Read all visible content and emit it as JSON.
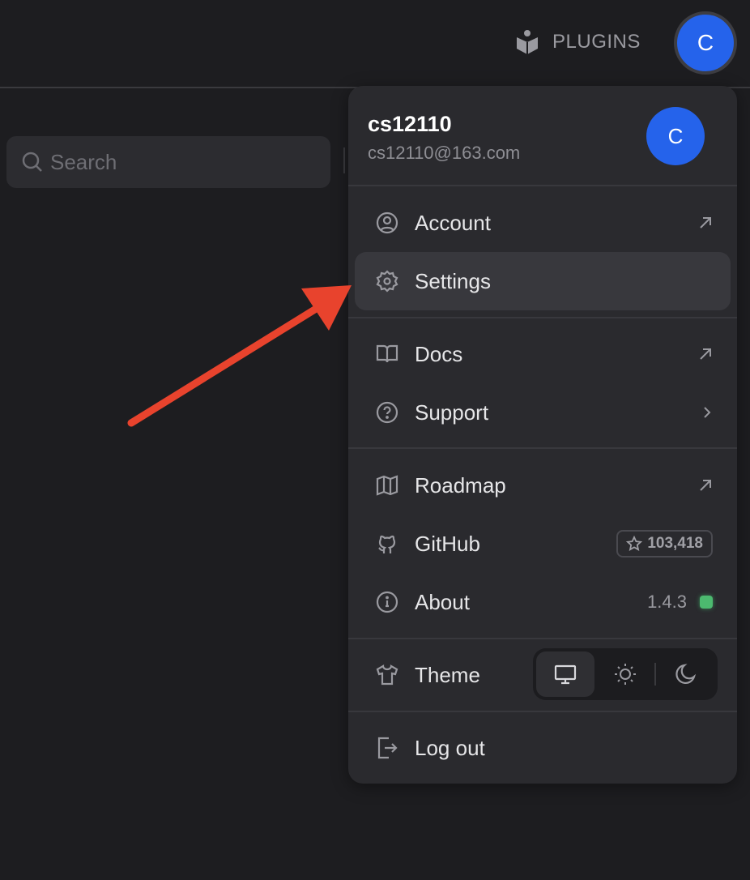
{
  "header": {
    "plugins_label": "PLUGINS",
    "avatar_initial": "C"
  },
  "search": {
    "placeholder": "Search"
  },
  "user": {
    "name": "cs12110",
    "email": "cs12110@163.com",
    "avatar_initial": "C"
  },
  "menu": {
    "account": "Account",
    "settings": "Settings",
    "docs": "Docs",
    "support": "Support",
    "roadmap": "Roadmap",
    "github": "GitHub",
    "github_stars": "103,418",
    "about": "About",
    "version": "1.4.3",
    "theme": "Theme",
    "logout": "Log out"
  },
  "theme": {
    "options": [
      "system",
      "light",
      "dark"
    ],
    "selected": "system"
  },
  "colors": {
    "accent": "#2563eb",
    "status": "#4cb96f",
    "annotation_arrow": "#e8432d"
  }
}
